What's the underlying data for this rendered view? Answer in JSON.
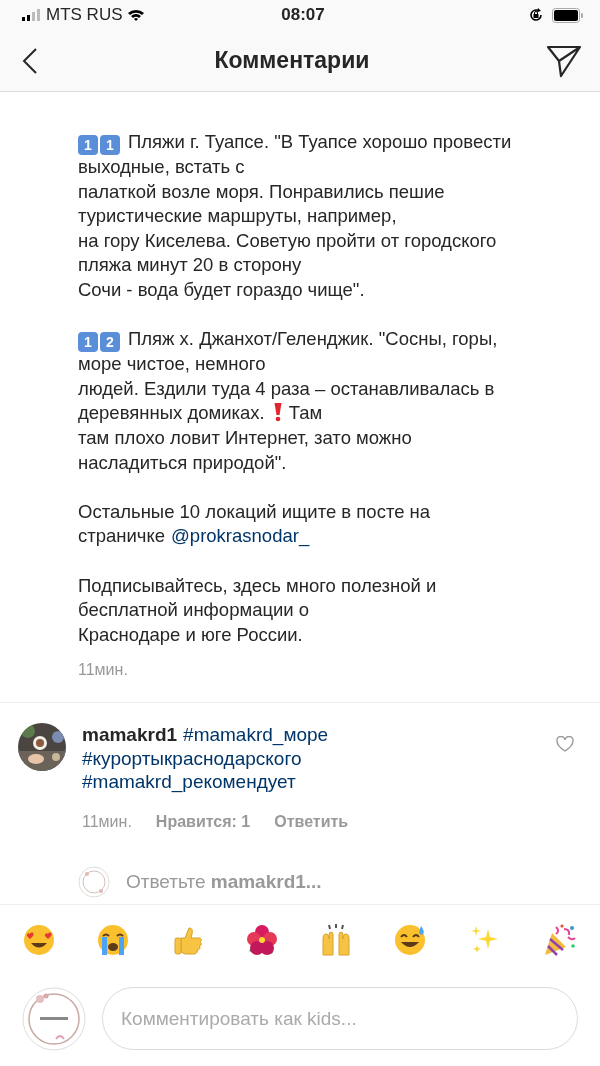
{
  "status_bar": {
    "carrier": "MTS RUS",
    "time": "08:07"
  },
  "header": {
    "title": "Комментарии"
  },
  "caption": {
    "paragraphs": [
      [
        [
          {
            "kind": "keycap",
            "text": "1"
          },
          {
            "kind": "keycap",
            "text": "1"
          },
          {
            "kind": "text",
            "text": "Пляжи г. Туапсе. \"В Туапсе хорошо провести"
          }
        ],
        [
          {
            "kind": "text",
            "text": "выходные, встать с"
          }
        ],
        [
          {
            "kind": "text",
            "text": "палаткой возле моря. Понравились пешие"
          }
        ],
        [
          {
            "kind": "text",
            "text": "туристические маршруты, например,"
          }
        ],
        [
          {
            "kind": "text",
            "text": "на гору Киселева. Советую пройти от городского"
          }
        ],
        [
          {
            "kind": "text",
            "text": "пляжа минут 20 в сторону"
          }
        ],
        [
          {
            "kind": "text",
            "text": "Сочи - вода будет гораздо чище\"."
          }
        ]
      ],
      [
        [
          {
            "kind": "keycap",
            "text": "1"
          },
          {
            "kind": "keycap",
            "text": "2"
          },
          {
            "kind": "text",
            "text": "Пляж х. Джанхот/Геленджик. \"Сосны, горы,"
          }
        ],
        [
          {
            "kind": "text",
            "text": "море чистое, немного"
          }
        ],
        [
          {
            "kind": "text",
            "text": "людей. Ездили туда 4 раза – останавливалась в"
          }
        ],
        [
          {
            "kind": "text",
            "text": "деревянных домиках."
          },
          {
            "kind": "alert"
          },
          {
            "kind": "text",
            "text": "Там"
          }
        ],
        [
          {
            "kind": "text",
            "text": "там плохо ловит Интернет, зато можно"
          }
        ],
        [
          {
            "kind": "text",
            "text": "насладиться природой\"."
          }
        ]
      ],
      [
        [
          {
            "kind": "text",
            "text": "Остальные 10 локаций ищите в посте на"
          }
        ],
        [
          {
            "kind": "text",
            "text": "страничке"
          },
          {
            "kind": "mention",
            "text": "@prokrasnodar_"
          }
        ]
      ],
      [
        [
          {
            "kind": "text",
            "text": "Подписывайтесь, здесь много полезной и"
          }
        ],
        [
          {
            "kind": "text",
            "text": "бесплатной информации о"
          }
        ],
        [
          {
            "kind": "text",
            "text": "Краснодаре и юге России."
          }
        ]
      ]
    ],
    "time": "11мин."
  },
  "comment": {
    "username": "mamakrd1",
    "hashtags": [
      "#mamakrd_море",
      "#курортыкраснодарского",
      "#mamakrd_рекомендует"
    ],
    "time": "11мин.",
    "likes": "Нравится: 1",
    "reply": "Ответить",
    "liked": false
  },
  "reply_prompt": {
    "text": "Ответьте",
    "username": "mamakrd1..."
  },
  "emoji_bar": [
    {
      "kind": "heart_eyes"
    },
    {
      "kind": "crying"
    },
    {
      "kind": "thumbs_up"
    },
    {
      "kind": "hibiscus"
    },
    {
      "kind": "raised_hands"
    },
    {
      "kind": "sweat_smile"
    },
    {
      "kind": "sparkles"
    },
    {
      "kind": "party"
    }
  ],
  "composer": {
    "placeholder": "Комментировать как kids..."
  }
}
